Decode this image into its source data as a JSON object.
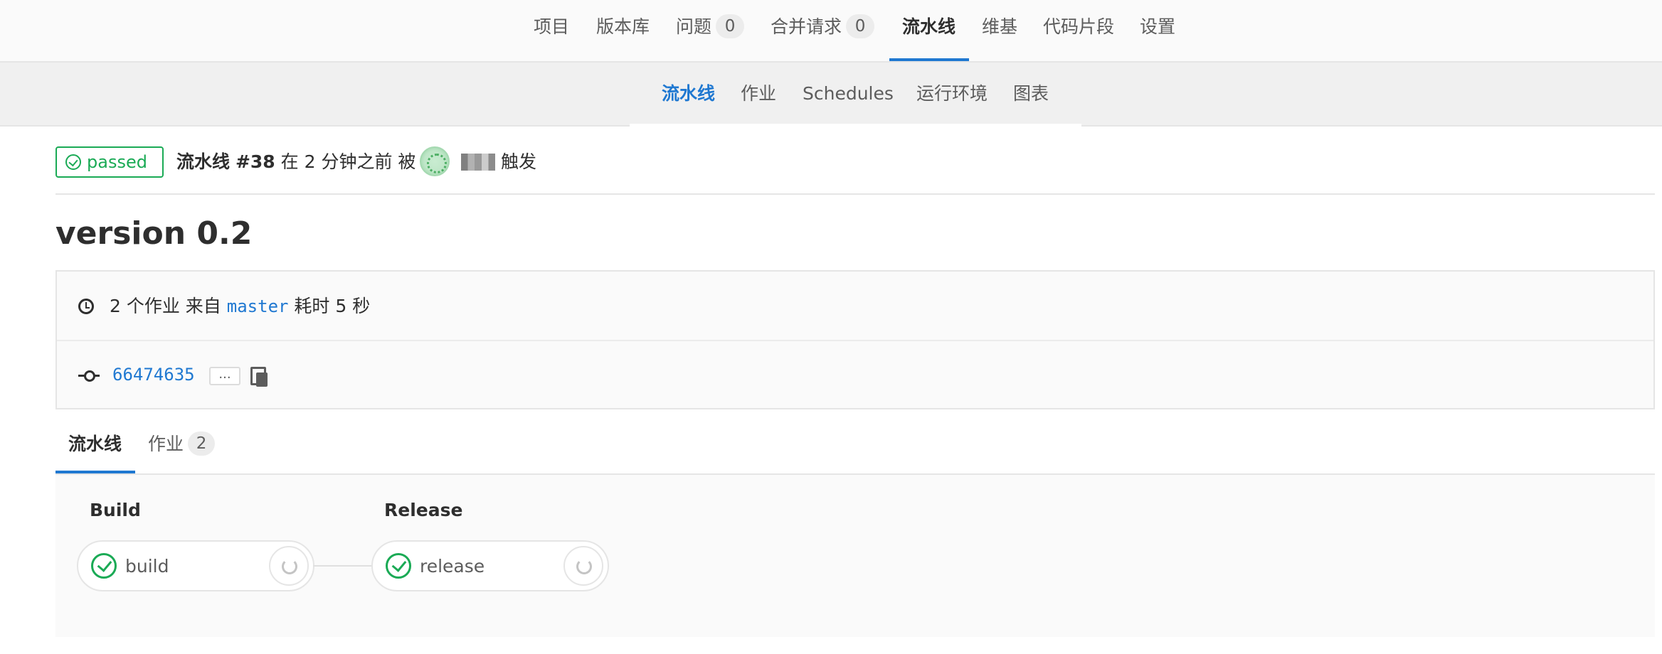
{
  "top_nav": {
    "items": [
      {
        "label": "项目"
      },
      {
        "label": "版本库"
      },
      {
        "label": "问题",
        "count": "0"
      },
      {
        "label": "合并请求",
        "count": "0"
      },
      {
        "label": "流水线",
        "active": true
      },
      {
        "label": "维基"
      },
      {
        "label": "代码片段"
      },
      {
        "label": "设置"
      }
    ]
  },
  "sub_nav": {
    "items": [
      {
        "label": "流水线",
        "active": true
      },
      {
        "label": "作业"
      },
      {
        "label": "Schedules"
      },
      {
        "label": "运行环境"
      },
      {
        "label": "图表"
      }
    ]
  },
  "pipeline_header": {
    "status": "passed",
    "label": "流水线",
    "number": "#38",
    "time_text": "在 2 分钟之前 被",
    "triggered_text": "触发"
  },
  "title": "version 0.2",
  "info": {
    "jobs_prefix": "2 个作业 来自",
    "branch": "master",
    "duration_text": "耗时 5 秒",
    "commit_sha": "66474635",
    "ellipsis": "..."
  },
  "tabs": [
    {
      "label": "流水线",
      "active": true
    },
    {
      "label": "作业",
      "count": "2"
    }
  ],
  "stages": [
    {
      "title": "Build",
      "jobs": [
        {
          "name": "build",
          "status": "passed"
        }
      ]
    },
    {
      "title": "Release",
      "jobs": [
        {
          "name": "release",
          "status": "passed"
        }
      ]
    }
  ],
  "colors": {
    "accent": "#1f78d1",
    "success": "#1aaa55",
    "text": "#2e2e2e",
    "muted": "#5c5c5c"
  },
  "icons": [
    "check-circle-icon",
    "clock-icon",
    "commit-icon",
    "copy-icon",
    "retry-icon"
  ]
}
